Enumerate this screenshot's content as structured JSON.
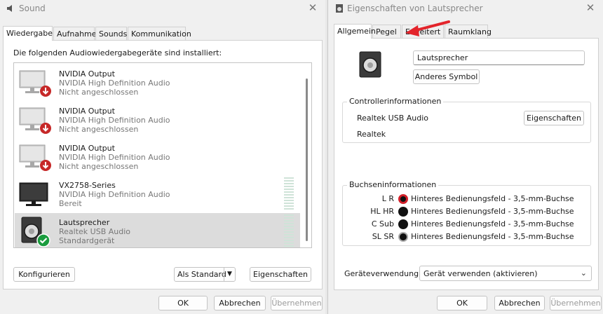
{
  "sound": {
    "title": "Sound",
    "close": "✕",
    "tabs": [
      "Wiedergabe",
      "Aufnahme",
      "Sounds",
      "Kommunikation"
    ],
    "intro": "Die folgenden Audiowiedergabegeräte sind installiert:",
    "devices": [
      {
        "name": "NVIDIA Output",
        "driver": "NVIDIA High Definition Audio",
        "status": "Nicht angeschlossen",
        "icon": "monitor-speaker-disconnected-icon"
      },
      {
        "name": "NVIDIA Output",
        "driver": "NVIDIA High Definition Audio",
        "status": "Nicht angeschlossen",
        "icon": "monitor-speaker-disconnected-icon"
      },
      {
        "name": "NVIDIA Output",
        "driver": "NVIDIA High Definition Audio",
        "status": "Nicht angeschlossen",
        "icon": "monitor-speaker-disconnected-icon"
      },
      {
        "name": "VX2758-Series",
        "driver": "NVIDIA High Definition Audio",
        "status": "Bereit",
        "icon": "monitor-icon"
      },
      {
        "name": "Lautsprecher",
        "driver": "Realtek USB Audio",
        "status": "Standardgerät",
        "icon": "speaker-default-icon",
        "selected": true
      }
    ],
    "buttons": {
      "configure": "Konfigurieren",
      "set_default": "Als Standard",
      "properties": "Eigenschaften"
    },
    "footer": {
      "ok": "OK",
      "cancel": "Abbrechen",
      "apply": "Übernehmen"
    }
  },
  "props": {
    "title": "Eigenschaften von Lautsprecher",
    "close": "✕",
    "tabs": [
      "Allgemein",
      "Pegel",
      "Erweitert",
      "Raumklang"
    ],
    "device_name": "Lautsprecher",
    "change_icon": "Anderes Symbol",
    "controller": {
      "title": "Controllerinformationen",
      "name": "Realtek USB Audio",
      "vendor": "Realtek",
      "properties": "Eigenschaften"
    },
    "jacks": {
      "title": "Buchseninformationen",
      "rows": [
        {
          "label": "L R",
          "desc": "Hinteres Bedienungsfeld - 3,5-mm-Buchse",
          "style": "red"
        },
        {
          "label": "HL HR",
          "desc": "Hinteres Bedienungsfeld - 3,5-mm-Buchse",
          "style": "black"
        },
        {
          "label": "C Sub",
          "desc": "Hinteres Bedienungsfeld - 3,5-mm-Buchse",
          "style": "black"
        },
        {
          "label": "SL SR",
          "desc": "Hinteres Bedienungsfeld - 3,5-mm-Buchse",
          "style": "grey"
        }
      ]
    },
    "usage": {
      "label": "Geräteverwendung:",
      "value": "Gerät verwenden (aktivieren)"
    },
    "footer": {
      "ok": "OK",
      "cancel": "Abbrechen",
      "apply": "Übernehmen"
    }
  },
  "colors": {
    "accent_green": "#1a9c3e",
    "alert_red": "#d2202a",
    "arrow_red": "#e3242b"
  }
}
